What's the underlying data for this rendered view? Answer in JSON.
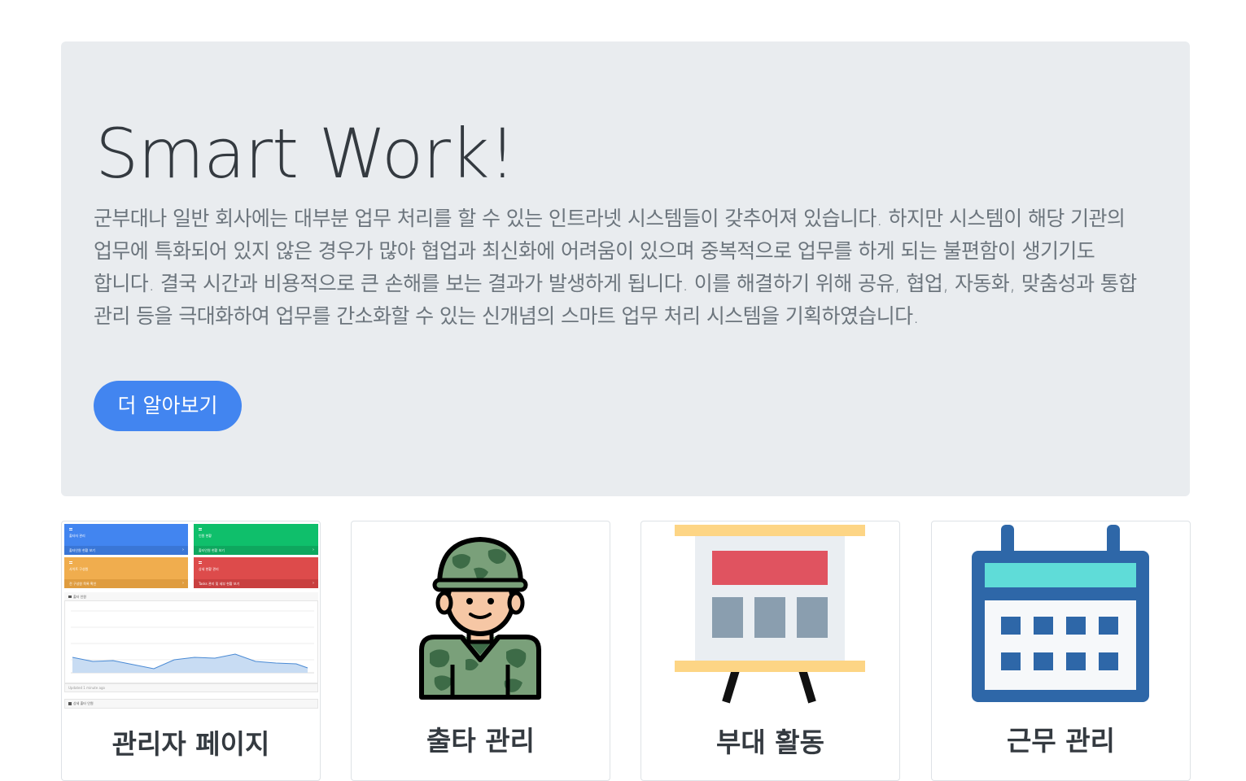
{
  "hero": {
    "title": "Smart Work!",
    "lead": "군부대나 일반 회사에는 대부분 업무 처리를 할 수 있는 인트라넷 시스템들이 갖추어져 있습니다. 하지만 시스템이 해당 기관의 업무에 특화되어 있지 않은 경우가 많아 협업과 최신화에 어려움이 있으며 중복적으로 업무를 하게 되는 불편함이 생기기도 합니다. 결국 시간과 비용적으로 큰 손해를 보는 결과가 발생하게 됩니다. 이를 해결하기 위해 공유, 협업, 자동화, 맞춤성과 통합 관리 등을 극대화하여 업무를 간소화할 수 있는 신개념의 스마트 업무 처리 시스템을 기획하였습니다.",
    "button_label": "더 알아보기"
  },
  "cards": [
    {
      "title": "관리자 페이지",
      "icon": "admin-dashboard-thumbnail",
      "thumbnail": {
        "boxes": [
          {
            "title": "출타자 관리",
            "footer": "출타인원 현황 보기"
          },
          {
            "title": "인원 현황",
            "footer": "출타인원 현황 보기"
          },
          {
            "title": "사이트 구성원",
            "footer": "전 구성원 목록 확인"
          },
          {
            "title": "상세 현황 관리",
            "footer": "Tasks 관리 및 세부 현황 보기"
          }
        ],
        "chart_label": "출타 인원",
        "footer_note": "Updated 1 minute ago",
        "table_label": "상세 출타 인원"
      }
    },
    {
      "title": "출타 관리",
      "icon": "soldier-icon"
    },
    {
      "title": "부대 활동",
      "icon": "presentation-board-icon"
    },
    {
      "title": "근무 관리",
      "icon": "calendar-icon"
    }
  ],
  "colors": {
    "hero_bg": "#e9ecef",
    "primary": "#4285f0",
    "title_text": "#343a40",
    "lead_text": "#6c757d",
    "thumb_blue": "#4285f0",
    "thumb_green": "#0fbf6b",
    "thumb_orange": "#f0ad4e",
    "thumb_red": "#dd4b4b"
  }
}
